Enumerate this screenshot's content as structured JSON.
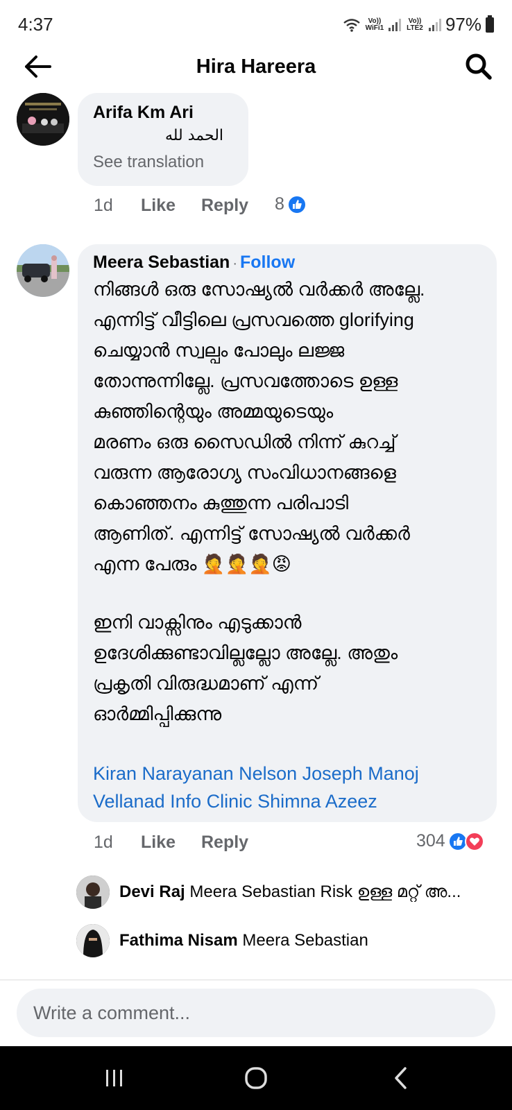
{
  "status": {
    "time": "4:37",
    "wifi_label": "Vo)) WiFi1",
    "lte_label": "Vo)) LTE2",
    "battery": "97%"
  },
  "header": {
    "title": "Hira Hareera"
  },
  "comments": [
    {
      "author": "Arifa Km Ari",
      "text": "الحمد لله",
      "see_translation": "See translation",
      "time": "1d",
      "like": "Like",
      "reply": "Reply",
      "reaction_count": "8"
    },
    {
      "author": "Meera Sebastian",
      "follow_sep": "·",
      "follow": "Follow",
      "lines": [
        "നിങ്ങൾ ഒരു സോഷ്യൽ വർക്കർ അല്ലേ.",
        "എന്നിട്ട് വീട്ടിലെ പ്രസവത്തെ glorifying",
        "ചെയ്യാൻ സ്വല്പം പോലും ലജ്ജ",
        "തോന്നുന്നില്ലേ. പ്രസവത്തോടെ ഉള്ള",
        "കുഞ്ഞിന്റെയും അമ്മയുടെയും",
        "മരണം ഒരു സൈഡിൽ നിന്ന് കുറച്ച്",
        "വരുന്ന ആരോഗ്യ സംവിധാനങ്ങളെ",
        "കൊഞ്ഞനം കുത്തുന്ന പരിപാടി",
        "ആണിത്. എന്നിട്ട് സോഷ്യൽ വർക്കർ",
        "എന്ന പേരും 🤦🤦🤦😡"
      ],
      "lines2": [
        "ഇനി വാക്സിനും എടുക്കാൻ",
        "ഉദേശിക്കുണ്ടാവില്ലല്ലോ അല്ലേ. അതും",
        "പ്രകൃതി വിരുദ്ധമാണ് എന്ന്",
        "ഓർമ്മിപ്പിക്കുന്നു"
      ],
      "tags": [
        "Kiran Narayanan Nelson Joseph Manoj",
        "Vellanad Info Clinic Shimna Azeez"
      ],
      "time": "1d",
      "like": "Like",
      "reply": "Reply",
      "reaction_count": "304"
    }
  ],
  "replies": [
    {
      "author": "Devi Raj",
      "text": "Meera Sebastian Risk ഉള്ള മറ്റ് അ..."
    },
    {
      "author": "Fathima Nisam",
      "text": "Meera Sebastian"
    }
  ],
  "composer": {
    "placeholder": "Write a comment..."
  },
  "colors": {
    "accent": "#1877f2",
    "bubble": "#f0f2f5",
    "meta": "#65676b",
    "love": "#f33e58"
  }
}
